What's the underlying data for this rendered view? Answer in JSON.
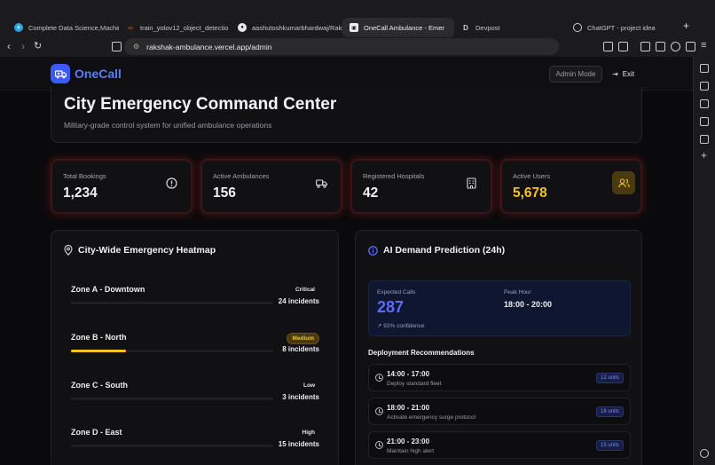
{
  "browser": {
    "tabs": [
      {
        "label": "Complete Data Science,Machin",
        "icon": "telegram-icon",
        "active": false
      },
      {
        "label": "train_yolov12_object_detectio",
        "icon": "glasses-icon",
        "active": false
      },
      {
        "label": "aashutoshkumarbhardwaj/Raksh",
        "icon": "github-icon",
        "active": false
      },
      {
        "label": "OneCall Ambulance - Emer",
        "icon": "ambulance-icon",
        "active": true
      },
      {
        "label": "Devpost",
        "icon": "devpost-icon",
        "active": false
      },
      {
        "label": "ChatGPT - project idea",
        "icon": "chatgpt-icon",
        "active": false
      }
    ],
    "url": "rakshak-ambulance.vercel.app/admin"
  },
  "header": {
    "brand": "OneCall",
    "admin_mode": "Admin Mode",
    "exit": "Exit"
  },
  "hero": {
    "title": "City Emergency Command Center",
    "subtitle": "Military-grade control system for unified ambulance operations"
  },
  "stats": [
    {
      "label": "Total Bookings",
      "value": "1,234",
      "icon": "alert-circle-icon"
    },
    {
      "label": "Active Ambulances",
      "value": "156",
      "icon": "truck-icon"
    },
    {
      "label": "Registered Hospitals",
      "value": "42",
      "icon": "hospital-icon"
    },
    {
      "label": "Active Users",
      "value": "5,678",
      "icon": "users-icon"
    }
  ],
  "heatmap": {
    "title": "City-Wide Emergency Heatmap",
    "zones": [
      {
        "name": "Zone A - Downtown",
        "severity": "Critical",
        "incidents": "24 incidents",
        "level": 0
      },
      {
        "name": "Zone B - North",
        "severity": "Medium",
        "incidents": "8 incidents",
        "level": 0.27
      },
      {
        "name": "Zone C - South",
        "severity": "Low",
        "incidents": "3 incidents",
        "level": 0
      },
      {
        "name": "Zone D - East",
        "severity": "High",
        "incidents": "15 incidents",
        "level": 0
      }
    ]
  },
  "prediction": {
    "title": "AI Demand Prediction (24h)",
    "expected_calls_label": "Expected Calls",
    "expected_calls": "287",
    "peak_hour_label": "Peak Hour",
    "peak_hour": "18:00 - 20:00",
    "confidence": "92% confidence",
    "recommendations_title": "Deployment Recommendations",
    "recommendations": [
      {
        "time": "14:00 - 17:00",
        "desc": "Deploy standard fleet",
        "units": "12 units"
      },
      {
        "time": "18:00 - 21:00",
        "desc": "Activate emergency surge protocol",
        "units": "18 units"
      },
      {
        "time": "21:00 - 23:00",
        "desc": "Maintain high alert",
        "units": "15 units"
      }
    ]
  },
  "colors": {
    "accent": "#3b5bff",
    "gold": "#f5c518",
    "glow": "#dc2828"
  }
}
